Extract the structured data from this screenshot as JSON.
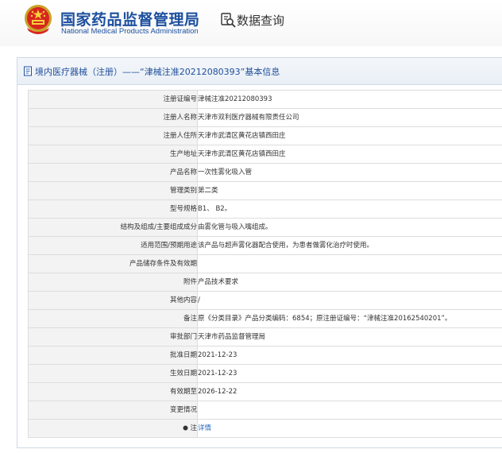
{
  "header": {
    "agency_cn": "国家药品监督管理局",
    "agency_en": "National Medical Products Administration",
    "query_title": "数据查询",
    "brand_color": "#1d4f9e"
  },
  "panel": {
    "title": "境内医疗器械（注册）——“津械注准20212080393”基本信息"
  },
  "rows": [
    {
      "label": "注册证编号",
      "value": "津械注准20212080393"
    },
    {
      "label": "注册人名称",
      "value": "天津市双利医疗器械有限责任公司"
    },
    {
      "label": "注册人住所",
      "value": "天津市武清区黄花店镇西田庄"
    },
    {
      "label": "生产地址",
      "value": "天津市武清区黄花店镇西田庄"
    },
    {
      "label": "产品名称",
      "value": "一次性雾化吸入管"
    },
    {
      "label": "管理类别",
      "value": "第二类"
    },
    {
      "label": "型号规格",
      "value": "B1、 B2。"
    },
    {
      "label": "结构及组成/主要组成成分",
      "value": "由雾化管与吸入嘴组成。"
    },
    {
      "label": "适用范围/预期用途",
      "value": "该产品与超声雾化器配合使用，为患者做雾化治疗时使用。"
    },
    {
      "label": "产品储存条件及有效期",
      "value": ""
    },
    {
      "label": "附件",
      "value": "产品技术要求"
    },
    {
      "label": "其他内容",
      "value": "/"
    },
    {
      "label": "备注",
      "value": "原《分类目录》产品分类编码：6854；原注册证编号：“津械注准20162540201”。"
    },
    {
      "label": "审批部门",
      "value": "天津市药品监督管理局"
    },
    {
      "label": "批准日期",
      "value": "2021-12-23"
    },
    {
      "label": "生效日期",
      "value": "2021-12-23"
    },
    {
      "label": "有效期至",
      "value": "2026-12-22"
    },
    {
      "label": "变更情况",
      "value": ""
    }
  ],
  "note_row": {
    "label": "注",
    "link": "详情"
  }
}
